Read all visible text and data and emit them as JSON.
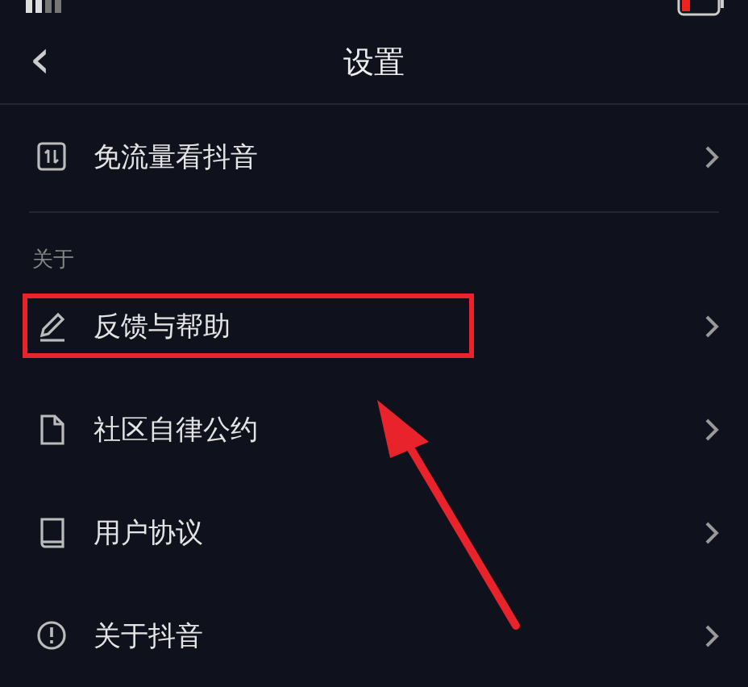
{
  "nav": {
    "back": "‹",
    "title": "设置"
  },
  "sections": [
    {
      "items": [
        {
          "label": "免流量看抖音",
          "highlighted": false
        }
      ]
    },
    {
      "label": "关于",
      "items": [
        {
          "label": "反馈与帮助",
          "highlighted": true
        },
        {
          "label": "社区自律公约",
          "highlighted": false
        },
        {
          "label": "用户协议",
          "highlighted": false
        },
        {
          "label": "关于抖音",
          "highlighted": false
        }
      ]
    }
  ]
}
